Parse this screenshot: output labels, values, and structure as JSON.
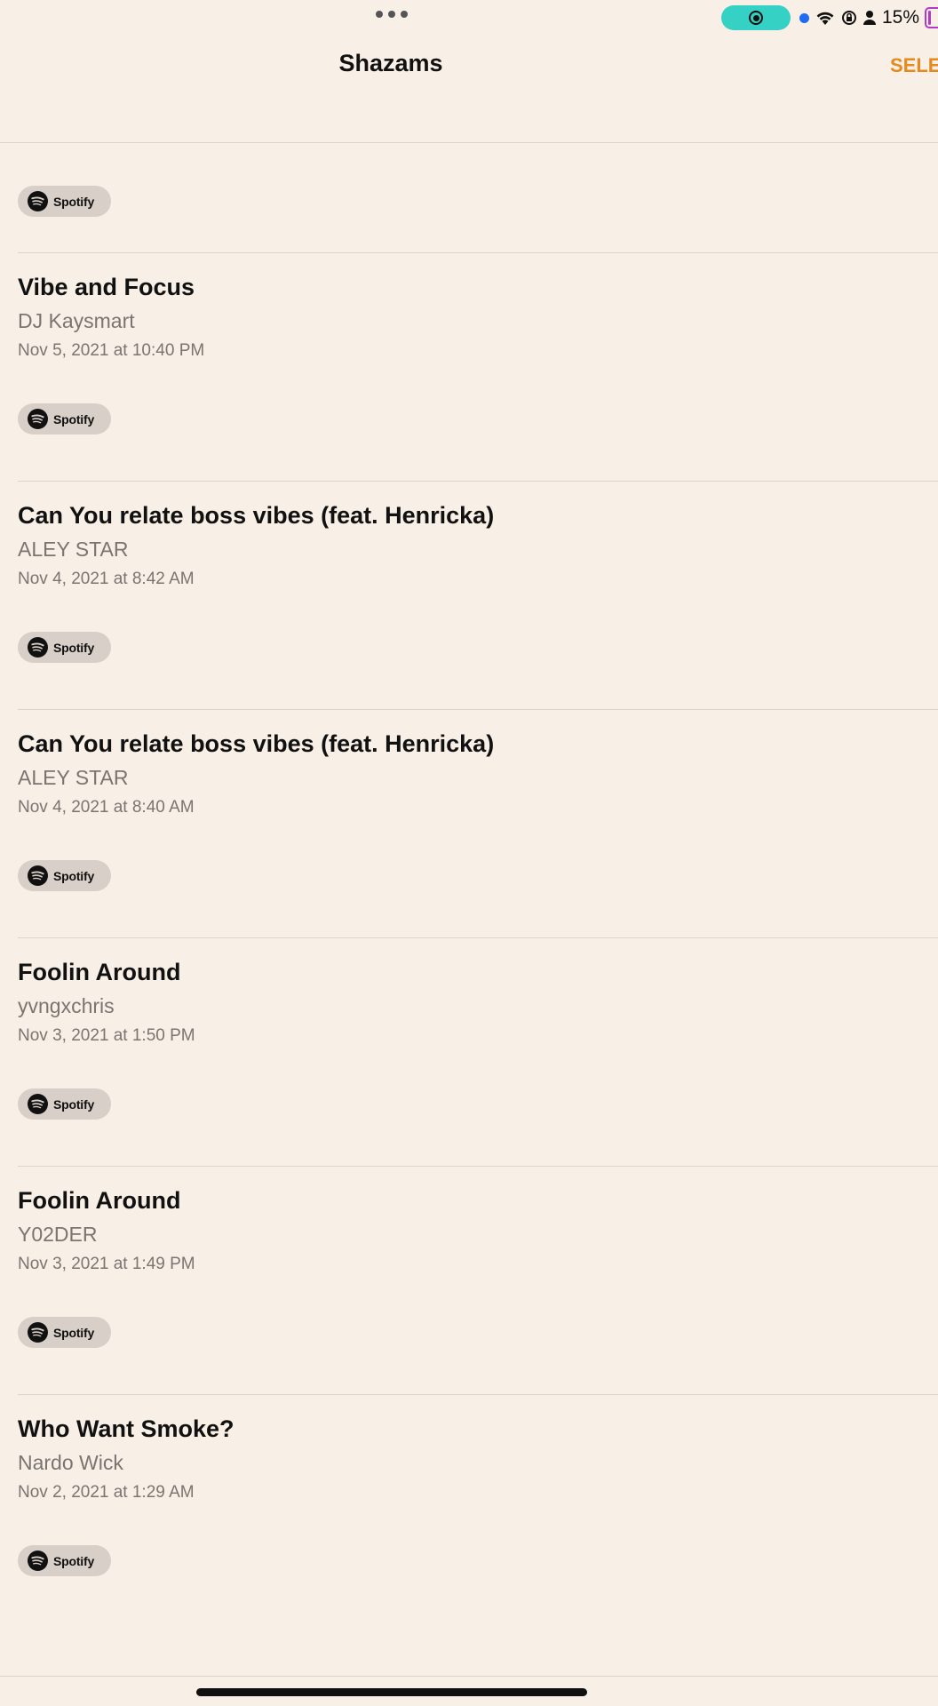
{
  "status_bar": {
    "battery_percent": "15%",
    "recording_color": "#34d1c4",
    "icons": [
      "more-dots-icon",
      "screen-record-icon",
      "location-dot-icon",
      "wifi-icon",
      "rotation-lock-icon",
      "person-icon",
      "battery-icon"
    ]
  },
  "nav": {
    "title": "Shazams",
    "select_label": "SELE"
  },
  "accent_color": "#e58a1f",
  "chip_label": "Spotify",
  "items": [
    {
      "title": "Vibe and Focus",
      "artist": "DJ Kaysmart",
      "date": "Nov 5, 2021 at 10:40 PM"
    },
    {
      "title": "Can You relate boss vibes (feat. Henricka)",
      "artist": "ALEY STAR",
      "date": "Nov 4, 2021 at 8:42 AM"
    },
    {
      "title": "Can You relate boss vibes (feat. Henricka)",
      "artist": "ALEY STAR",
      "date": "Nov 4, 2021 at 8:40 AM"
    },
    {
      "title": "Foolin Around",
      "artist": "yvngxchris",
      "date": "Nov 3, 2021 at 1:50 PM"
    },
    {
      "title": "Foolin Around",
      "artist": "Y02DER",
      "date": "Nov 3, 2021 at 1:49 PM"
    },
    {
      "title": "Who Want Smoke?",
      "artist": "Nardo Wick",
      "date": "Nov 2, 2021 at 1:29 AM"
    }
  ]
}
